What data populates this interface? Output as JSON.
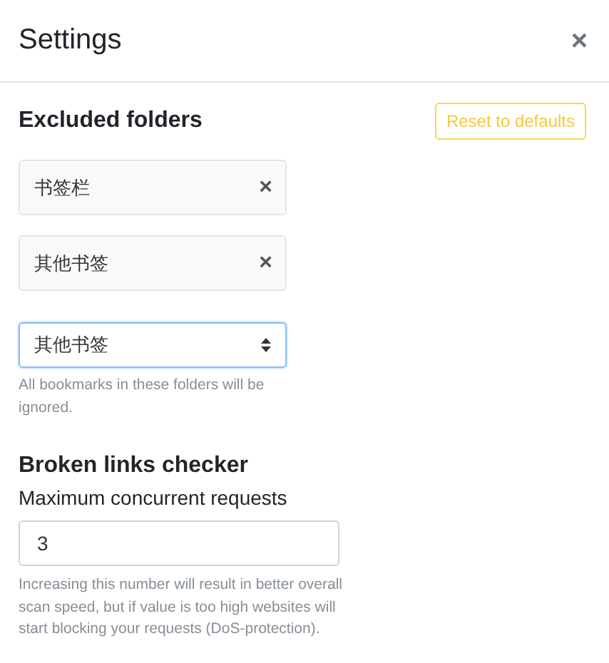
{
  "dialog": {
    "title": "Settings",
    "close": "×"
  },
  "excluded_folders": {
    "heading": "Excluded folders",
    "reset_button": "Reset to defaults",
    "folders": [
      {
        "name": "书签栏",
        "remove": "×"
      },
      {
        "name": "其他书签",
        "remove": "×"
      }
    ],
    "select": {
      "value": "其他书签"
    },
    "help": "All bookmarks in these folders will be ignored."
  },
  "broken_links": {
    "heading": "Broken links checker",
    "label": "Maximum concurrent requests",
    "value": "3",
    "help": "Increasing this number will result in better overall scan speed, but if value is too high websites will start blocking your requests (DoS-protection)."
  }
}
